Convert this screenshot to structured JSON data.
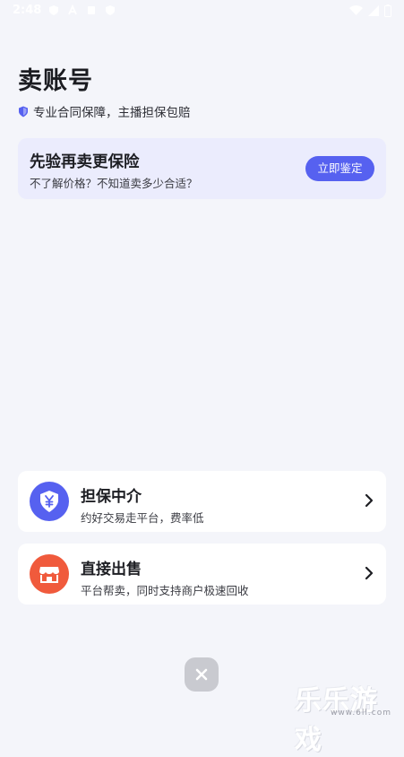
{
  "status_bar": {
    "time": "2:48",
    "icons_left": [
      "shield-icon",
      "text-icon",
      "shield-icon",
      "shield-icon"
    ],
    "icons_right": [
      "wifi-icon",
      "signal-icon",
      "battery-icon"
    ]
  },
  "header": {
    "title": "卖账号",
    "subtitle": "专业合同保障，主播担保包赔",
    "subtitle_icon": "shield-check-icon"
  },
  "verify_card": {
    "title": "先验再卖更保险",
    "description": "不了解价格？不知道卖多少合适？",
    "button_label": "立即鉴定"
  },
  "options": [
    {
      "title": "担保中介",
      "description": "约好交易走平台，费率低",
      "icon": "yen-shield-icon",
      "icon_color": "#5661f0"
    },
    {
      "title": "直接出售",
      "description": "平台帮卖，同时支持商户极速回收",
      "icon": "store-icon",
      "icon_color": "#f05a3c"
    }
  ],
  "close_button": {
    "icon": "close-icon"
  },
  "watermark": {
    "text": "乐乐游戏",
    "url": "www.6ll.com"
  },
  "colors": {
    "accent": "#5661f0",
    "background": "#f4f5fa",
    "card_tint": "#ebecfd",
    "store_red": "#f05a3c"
  }
}
